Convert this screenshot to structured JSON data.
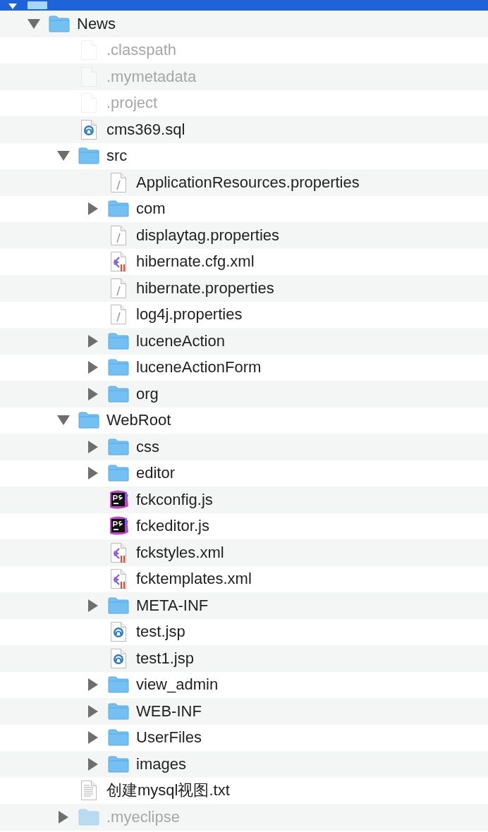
{
  "selected_row": {
    "selected": true,
    "expanded": true
  },
  "tree": [
    {
      "name": "News",
      "kind": "folder",
      "expanded": true,
      "dimmed": false,
      "children": [
        {
          "name": ".classpath",
          "kind": "blank",
          "dimmed": true
        },
        {
          "name": ".mymetadata",
          "kind": "blank",
          "dimmed": true
        },
        {
          "name": ".project",
          "kind": "blank",
          "dimmed": true
        },
        {
          "name": "cms369.sql",
          "kind": "sql",
          "dimmed": false
        },
        {
          "name": "src",
          "kind": "folder",
          "expanded": true,
          "dimmed": false,
          "children": [
            {
              "name": "ApplicationResources.properties",
              "kind": "properties",
              "dimmed": false
            },
            {
              "name": "com",
              "kind": "folder",
              "expanded": false,
              "dimmed": false
            },
            {
              "name": "displaytag.properties",
              "kind": "properties",
              "dimmed": false
            },
            {
              "name": "hibernate.cfg.xml",
              "kind": "xml",
              "dimmed": false
            },
            {
              "name": "hibernate.properties",
              "kind": "properties",
              "dimmed": false
            },
            {
              "name": "log4j.properties",
              "kind": "properties",
              "dimmed": false
            },
            {
              "name": "luceneAction",
              "kind": "folder",
              "expanded": false,
              "dimmed": false
            },
            {
              "name": "luceneActionForm",
              "kind": "folder",
              "expanded": false,
              "dimmed": false
            },
            {
              "name": "org",
              "kind": "folder",
              "expanded": false,
              "dimmed": false
            }
          ]
        },
        {
          "name": "WebRoot",
          "kind": "folder",
          "expanded": true,
          "dimmed": false,
          "children": [
            {
              "name": "css",
              "kind": "folder",
              "expanded": false,
              "dimmed": false
            },
            {
              "name": "editor",
              "kind": "folder",
              "expanded": false,
              "dimmed": false
            },
            {
              "name": "fckconfig.js",
              "kind": "script",
              "dimmed": false
            },
            {
              "name": "fckeditor.js",
              "kind": "script",
              "dimmed": false
            },
            {
              "name": "fckstyles.xml",
              "kind": "xml",
              "dimmed": false
            },
            {
              "name": "fcktemplates.xml",
              "kind": "xml",
              "dimmed": false
            },
            {
              "name": "META-INF",
              "kind": "folder",
              "expanded": false,
              "dimmed": false
            },
            {
              "name": "test.jsp",
              "kind": "sql",
              "dimmed": false
            },
            {
              "name": "test1.jsp",
              "kind": "sql",
              "dimmed": false
            },
            {
              "name": "view_admin",
              "kind": "folder",
              "expanded": false,
              "dimmed": false
            },
            {
              "name": "WEB-INF",
              "kind": "folder",
              "expanded": false,
              "dimmed": false
            },
            {
              "name": "UserFiles",
              "kind": "folder",
              "expanded": false,
              "dimmed": false
            },
            {
              "name": "images",
              "kind": "folder",
              "expanded": false,
              "dimmed": false
            }
          ]
        },
        {
          "name": "创建mysql视图.txt",
          "kind": "text",
          "dimmed": false
        },
        {
          "name": ".myeclipse",
          "kind": "folder",
          "expanded": false,
          "dimmed": true
        }
      ]
    }
  ]
}
